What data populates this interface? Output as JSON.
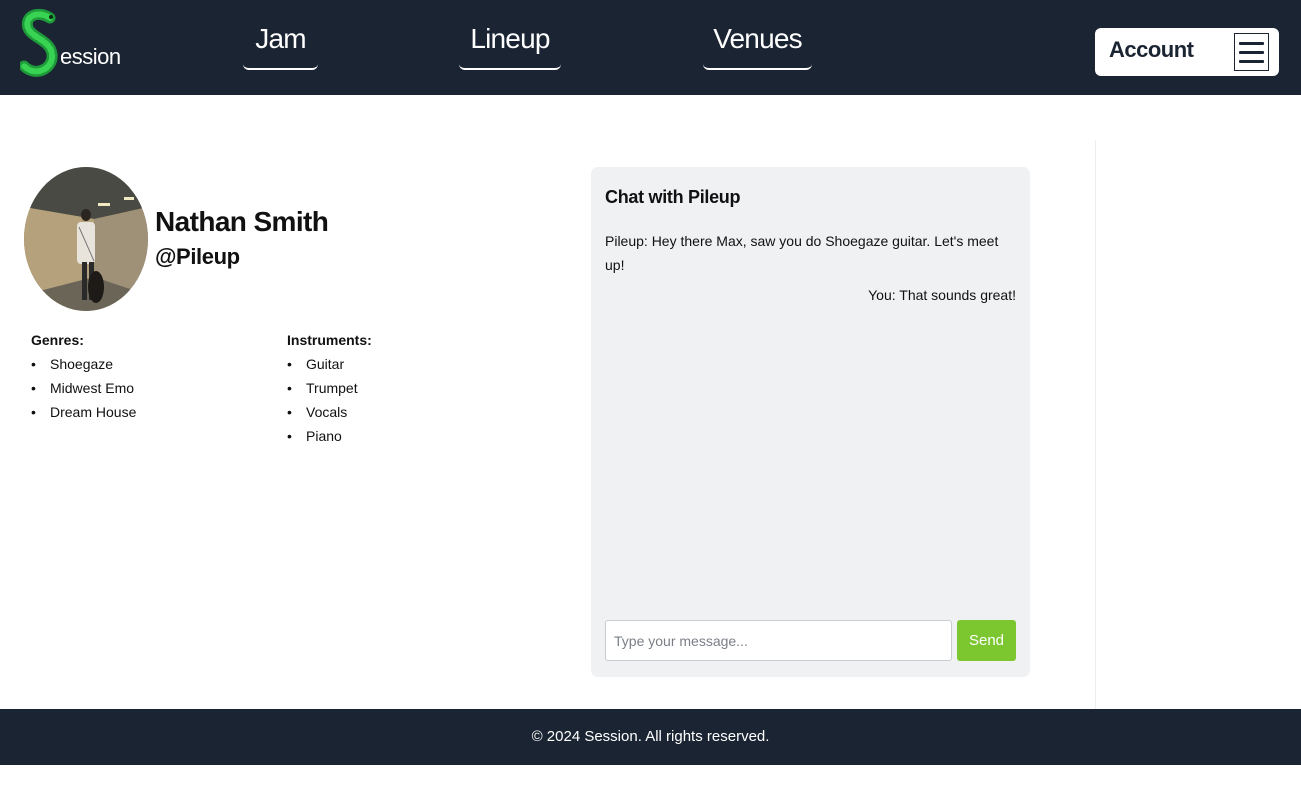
{
  "brand": {
    "logo_letter_icon": "green-worm-s-icon",
    "logo_text": "ession",
    "accent_color": "#22c55e"
  },
  "nav": {
    "jam": "Jam",
    "lineup": "Lineup",
    "venues": "Venues"
  },
  "account": {
    "label": "Account",
    "menu_icon": "hamburger-menu-icon"
  },
  "profile": {
    "name": "Nathan Smith",
    "handle": "@Pileup",
    "genres_title": "Genres:",
    "genres": [
      "Shoegaze",
      "Midwest Emo",
      "Dream House"
    ],
    "instruments_title": "Instruments:",
    "instruments": [
      "Guitar",
      "Trumpet",
      "Vocals",
      "Piano"
    ]
  },
  "chat": {
    "title": "Chat with Pileup",
    "messages": [
      {
        "from": "them",
        "text": "Pileup: Hey there Max, saw you do Shoegaze guitar. Let's meet up!"
      },
      {
        "from": "you",
        "text": "You: That sounds great!"
      }
    ],
    "input_placeholder": "Type your message...",
    "send_label": "Send",
    "send_color": "#7cc630"
  },
  "footer": {
    "text": "© 2024 Session. All rights reserved."
  },
  "colors": {
    "header_bg": "#1b2432",
    "chat_bg": "#f0f1f3"
  }
}
